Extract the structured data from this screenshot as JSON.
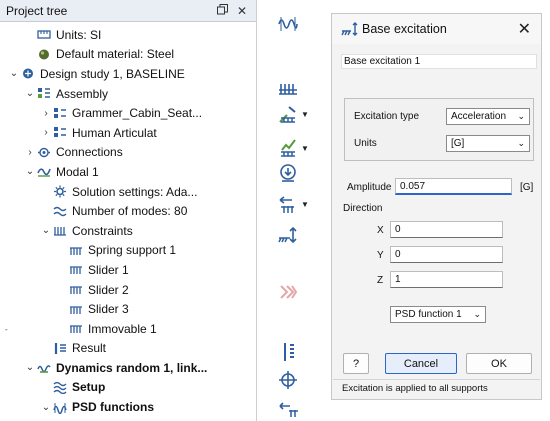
{
  "tree": {
    "title": "Project tree",
    "pin_glyph": "🗗",
    "close_glyph": "✕",
    "rows": [
      {
        "label": "Units: SI",
        "indent": 1,
        "chevron": "",
        "icon": "units-icon",
        "bold": false
      },
      {
        "label": "Default material: Steel",
        "indent": 1,
        "chevron": "",
        "icon": "material-icon",
        "bold": false
      },
      {
        "label": "Design study 1, BASELINE",
        "indent": 0,
        "chevron": "⌄",
        "icon": "design-study-icon",
        "bold": false
      },
      {
        "label": "Assembly",
        "indent": 1,
        "chevron": "⌄",
        "icon": "assembly-icon",
        "bold": false
      },
      {
        "label": "Grammer_Cabin_Seat...",
        "indent": 2,
        "chevron": "›",
        "icon": "part-icon",
        "bold": false
      },
      {
        "label": "Human Articulat",
        "indent": 2,
        "chevron": "›",
        "icon": "part-icon",
        "bold": false
      },
      {
        "label": "Connections",
        "indent": 1,
        "chevron": "›",
        "icon": "connections-icon",
        "bold": false
      },
      {
        "label": "Modal 1",
        "indent": 1,
        "chevron": "⌄",
        "icon": "modal-icon",
        "bold": false
      },
      {
        "label": "Solution settings: Ada...",
        "indent": 2,
        "chevron": "",
        "icon": "settings-icon",
        "bold": false
      },
      {
        "label": "Number of modes: 80",
        "indent": 2,
        "chevron": "",
        "icon": "modes-icon",
        "bold": false
      },
      {
        "label": "Constraints",
        "indent": 2,
        "chevron": "⌄",
        "icon": "constraints-icon",
        "bold": false
      },
      {
        "label": "Spring support 1",
        "indent": 3,
        "chevron": "",
        "icon": "support-icon",
        "bold": false
      },
      {
        "label": "Slider 1",
        "indent": 3,
        "chevron": "",
        "icon": "support-icon",
        "bold": false
      },
      {
        "label": "Slider 2",
        "indent": 3,
        "chevron": "",
        "icon": "support-icon",
        "bold": false
      },
      {
        "label": "Slider 3",
        "indent": 3,
        "chevron": "",
        "icon": "support-icon",
        "bold": false
      },
      {
        "label": "Immovable 1",
        "indent": 3,
        "chevron": "",
        "icon": "support-icon",
        "bold": false
      },
      {
        "label": "Result",
        "indent": 2,
        "chevron": "",
        "icon": "result-icon",
        "bold": false
      },
      {
        "label": "Dynamics random 1, link...",
        "indent": 1,
        "chevron": "⌄",
        "icon": "dynamics-icon",
        "bold": true
      },
      {
        "label": "Setup",
        "indent": 2,
        "chevron": "",
        "icon": "setup-icon",
        "bold": true
      },
      {
        "label": "PSD functions",
        "indent": 2,
        "chevron": "⌄",
        "icon": "psd-icon",
        "bold": true
      }
    ]
  },
  "dialog": {
    "title": "Base excitation",
    "close_glyph": "✕",
    "name_value": "Base excitation 1",
    "excitation_type_label": "Excitation type",
    "excitation_type_value": "Acceleration",
    "units_label": "Units",
    "units_value": "[G]",
    "amplitude_label": "Amplitude",
    "amplitude_value": "0.057",
    "amplitude_unit": "[G]",
    "direction_label": "Direction",
    "x_label": "X",
    "x_value": "0",
    "y_label": "Y",
    "y_value": "0",
    "z_label": "Z",
    "z_value": "1",
    "psd_value": "PSD function 1",
    "help_label": "?",
    "cancel_label": "Cancel",
    "ok_label": "OK",
    "status_text": "Excitation is applied to all supports"
  },
  "toolbar": {
    "items": [
      "wave-icon",
      "support-grid-icon",
      "slider-dropdown-icon",
      "spring-dropdown-icon",
      "pin-icon",
      "displacement-dropdown-icon",
      "base-excitation-icon",
      "chevrons-icon",
      "column-icon",
      "crosshair-icon",
      "push-icon"
    ]
  },
  "colors": {
    "accent": "#2b66c9",
    "icon_blue": "#2f5f9e",
    "icon_green": "#5a9a3a",
    "tree_header": "#e9eef5"
  },
  "misc": {
    "left_dash": "-"
  }
}
